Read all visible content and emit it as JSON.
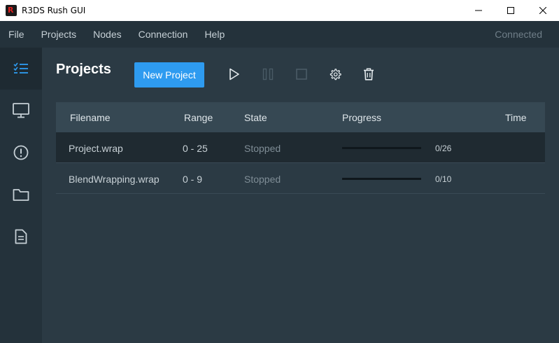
{
  "window": {
    "title": "R3DS Rush GUI"
  },
  "menu": {
    "items": [
      "File",
      "Projects",
      "Nodes",
      "Connection",
      "Help"
    ],
    "status": "Connected"
  },
  "main": {
    "title": "Projects",
    "new_project_label": "New Project"
  },
  "table": {
    "headers": {
      "filename": "Filename",
      "range": "Range",
      "state": "State",
      "progress": "Progress",
      "time": "Time"
    },
    "rows": [
      {
        "filename": "Project.wrap",
        "range": "0 - 25",
        "state": "Stopped",
        "progress_text": "0/26",
        "progress": 0,
        "time": ""
      },
      {
        "filename": "BlendWrapping.wrap",
        "range": "0 - 9",
        "state": "Stopped",
        "progress_text": "0/10",
        "progress": 0,
        "time": ""
      }
    ]
  },
  "colors": {
    "accent": "#2e9bf0",
    "sidebar": "#24323b",
    "background": "#2b3a44"
  }
}
